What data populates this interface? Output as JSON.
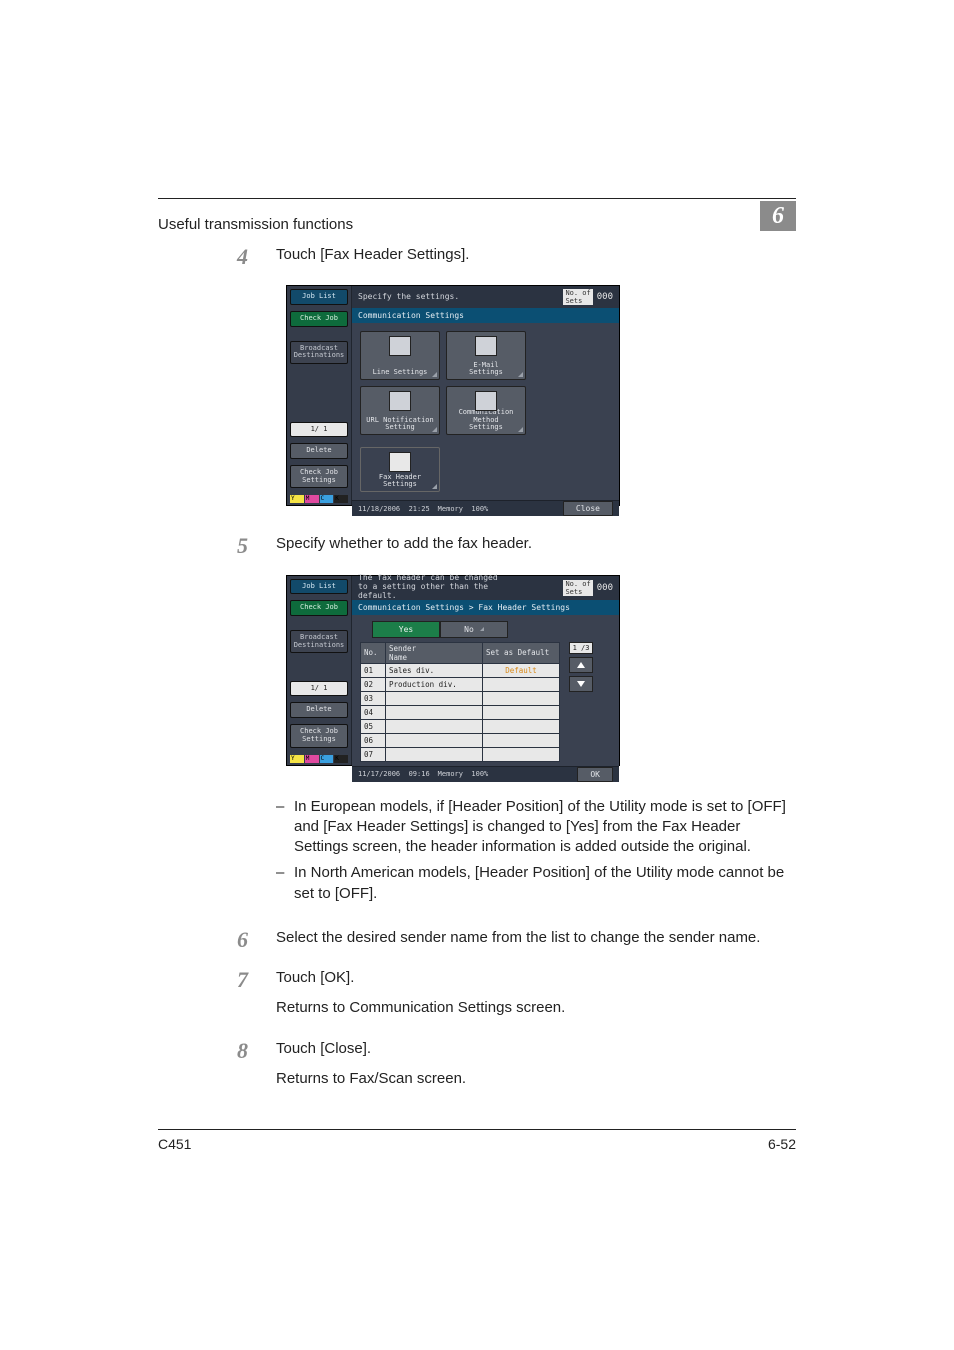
{
  "header": {
    "section_title": "Useful transmission functions",
    "chapter_number": "6"
  },
  "steps": {
    "s4": {
      "num": "4",
      "text": "Touch [Fax Header Settings]."
    },
    "s5": {
      "num": "5",
      "text": "Specify whether to add the fax header.",
      "notes": {
        "n1": "In European models, if [Header Position] of the Utility mode is set to [OFF] and [Fax Header Settings] is changed to [Yes] from the Fax Header Settings screen, the header information is added outside the original.",
        "n2": "In North American models, [Header Position] of the Utility mode cannot be set to [OFF]."
      }
    },
    "s6": {
      "num": "6",
      "text": "Select the desired sender name from the list to change the sender name."
    },
    "s7": {
      "num": "7",
      "text": "Touch [OK].",
      "result": "Returns to Communication Settings screen."
    },
    "s8": {
      "num": "8",
      "text": "Touch [Close].",
      "result": "Returns to Fax/Scan screen."
    }
  },
  "screenshot1": {
    "left": {
      "job_list": "Job List",
      "check_job": "Check Job",
      "broadcast": "Broadcast\nDestinations",
      "page": "1/  1",
      "delete": "Delete",
      "check_job_set": "Check Job\nSettings"
    },
    "top_text": "Specify the settings.",
    "copies_label": "No. of\nSets",
    "copies_num": "000",
    "blue_bar": "Communication Settings",
    "tiles": {
      "line": "Line Settings",
      "email": "E-Mail\nSettings",
      "url": "URL Notification\nSetting",
      "comm": "Communication Method\nSettings",
      "faxhdr": "Fax Header\nSettings"
    },
    "bottom": {
      "date": "11/18/2006",
      "time": "21:25",
      "mem_label": "Memory",
      "mem_val": "100%",
      "close": "Close"
    }
  },
  "screenshot2": {
    "left": {
      "job_list": "Job List",
      "check_job": "Check Job",
      "broadcast": "Broadcast\nDestinations",
      "page": "1/  1",
      "delete": "Delete",
      "check_job_set": "Check Job\nSettings"
    },
    "top_text": "The fax header can be changed\nto a setting other than the default.",
    "copies_label": "No. of\nSets",
    "copies_num": "000",
    "blue_bar": "Communication Settings > Fax Header Settings",
    "yes": "Yes",
    "no": "No",
    "table": {
      "h_no": "No.",
      "h_name": "Sender\nName",
      "h_def": "Set as Default",
      "rows": [
        {
          "no": "01",
          "name": "Sales div.",
          "def": "Default"
        },
        {
          "no": "02",
          "name": "Production div.",
          "def": ""
        },
        {
          "no": "03",
          "name": "",
          "def": ""
        },
        {
          "no": "04",
          "name": "",
          "def": ""
        },
        {
          "no": "05",
          "name": "",
          "def": ""
        },
        {
          "no": "06",
          "name": "",
          "def": ""
        },
        {
          "no": "07",
          "name": "",
          "def": ""
        }
      ],
      "page_indicator": "1 /3"
    },
    "bottom": {
      "date": "11/17/2006",
      "time": "09:16",
      "mem_label": "Memory",
      "mem_val": "100%",
      "ok": "OK"
    }
  },
  "footer": {
    "model": "C451",
    "page": "6-52"
  },
  "ymck": {
    "y": "Y",
    "m": "M",
    "c": "C",
    "k": "K"
  }
}
